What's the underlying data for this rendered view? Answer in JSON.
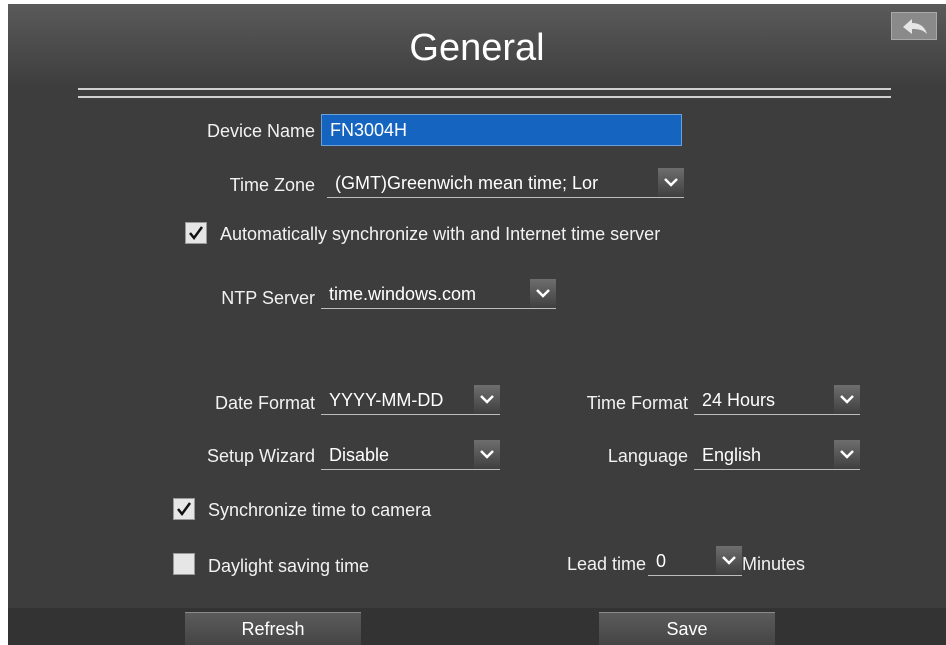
{
  "header": {
    "title": "General",
    "back_icon": "back-arrow-icon"
  },
  "device_name": {
    "label": "Device Name",
    "value": "FN3004H"
  },
  "time_zone": {
    "label": "Time Zone",
    "value": "(GMT)Greenwich mean time; Lor"
  },
  "auto_sync": {
    "label": "Automatically synchronize with and Internet time server",
    "checked": true
  },
  "ntp_server": {
    "label": "NTP Server",
    "value": "time.windows.com"
  },
  "date_format": {
    "label": "Date Format",
    "value": "YYYY-MM-DD"
  },
  "time_format": {
    "label": "Time Format",
    "value": "24 Hours"
  },
  "setup_wizard": {
    "label": "Setup Wizard",
    "value": "Disable"
  },
  "language": {
    "label": "Language",
    "value": "English"
  },
  "sync_camera": {
    "label": "Synchronize time to camera",
    "checked": true
  },
  "daylight_saving": {
    "label": "Daylight saving time",
    "checked": false
  },
  "lead_time": {
    "label": "Lead time",
    "value": "0",
    "unit": "Minutes"
  },
  "buttons": {
    "refresh": "Refresh",
    "save": "Save"
  },
  "colors": {
    "background": "#3d3d3d",
    "input_highlight": "#1565c0",
    "text": "#ffffff"
  }
}
